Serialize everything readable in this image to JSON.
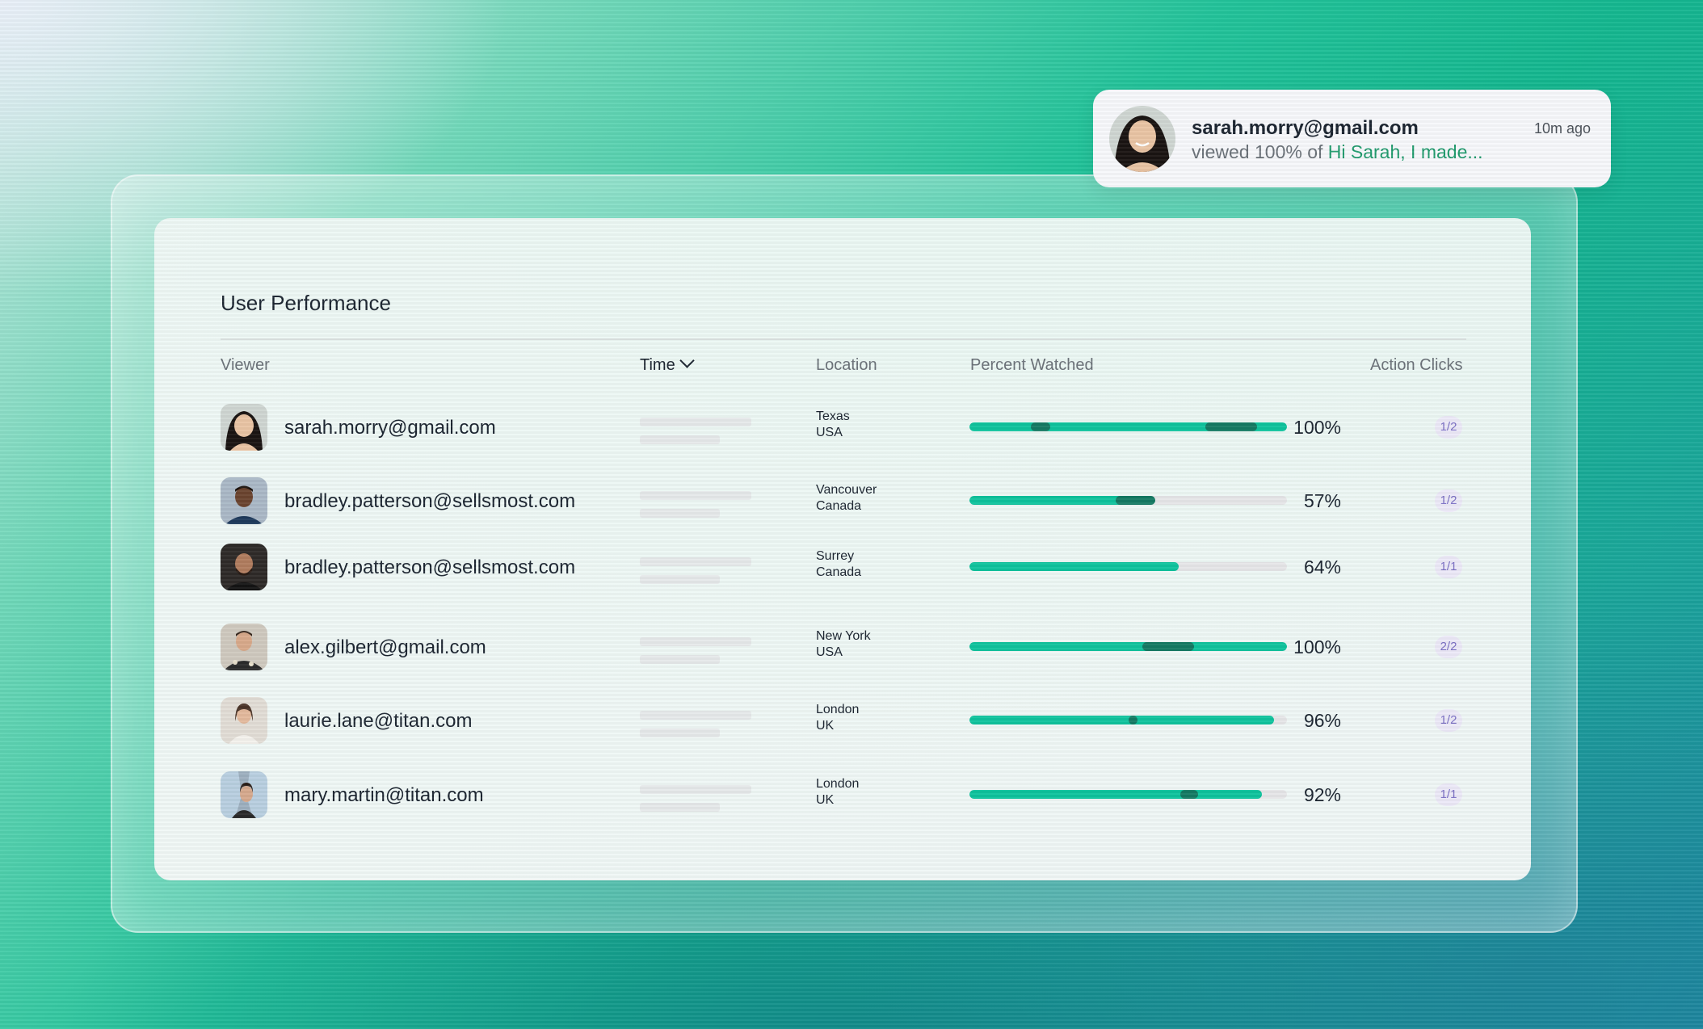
{
  "notification": {
    "email": "sarah.morry@gmail.com",
    "message_prefix": "viewed 100% of ",
    "message_highlight": "Hi Sarah, I made...",
    "time_ago": "10m ago"
  },
  "panel": {
    "title": "User Performance",
    "columns": {
      "viewer": "Viewer",
      "time": "Time",
      "location": "Location",
      "percent_watched": "Percent Watched",
      "action_clicks": "Action Clicks"
    }
  },
  "rows": [
    {
      "email": "sarah.morry@gmail.com",
      "loc1": "Texas",
      "loc2": "USA",
      "percent": "100%",
      "clicks": "1/2",
      "watched": 1.0,
      "skin": "#e9c4a4",
      "hair": "#1a1412",
      "bg": "#cfd6d2"
    },
    {
      "email": "bradley.patterson@sellsmost.com",
      "loc1": "Vancouver",
      "loc2": "Canada",
      "percent": "57%",
      "clicks": "1/2",
      "watched": 0.57,
      "skin": "#6b4430",
      "hair": "#1b120d",
      "bg": "#aab8c6"
    },
    {
      "email": "bradley.patterson@sellsmost.com",
      "loc1": "Surrey",
      "loc2": "Canada",
      "percent": "64%",
      "clicks": "1/1",
      "watched": 0.64,
      "skin": "#b07c5e",
      "hair": "#2a1d16",
      "bg": "#2e2a28"
    },
    {
      "email": "alex.gilbert@gmail.com",
      "loc1": "New York",
      "loc2": "USA",
      "percent": "100%",
      "clicks": "2/2",
      "watched": 1.0,
      "skin": "#d8a98a",
      "hair": "#3a2a20",
      "bg": "#cfc9bf"
    },
    {
      "email": "laurie.lane@titan.com",
      "loc1": "London",
      "loc2": "UK",
      "percent": "96%",
      "clicks": "1/2",
      "watched": 0.96,
      "skin": "#e3b99c",
      "hair": "#4a3428",
      "bg": "#e2ddd6"
    },
    {
      "email": "mary.martin@titan.com",
      "loc1": "London",
      "loc2": "UK",
      "percent": "92%",
      "clicks": "1/1",
      "watched": 0.92,
      "skin": "#d6a98d",
      "hair": "#2a1e18",
      "bg": "#b9cfe0"
    }
  ],
  "colors": {
    "accent": "#0fc39d",
    "accent_dark": "#157a63",
    "track": "#e6e6e8",
    "badge_bg": "#ece9f8",
    "badge_text": "#7b6fc4"
  }
}
